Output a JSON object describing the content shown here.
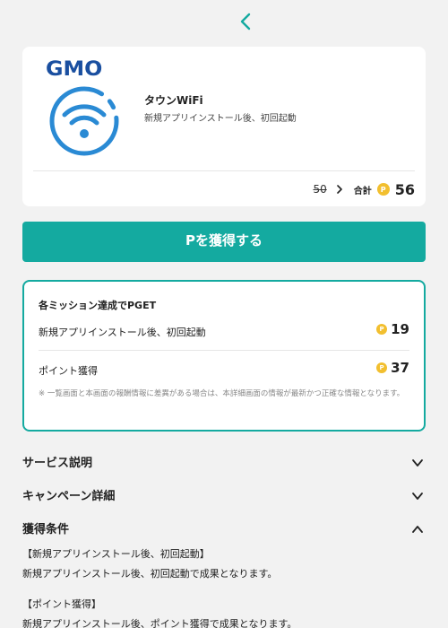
{
  "nav": {
    "back_icon": "chevron-left-icon"
  },
  "app": {
    "logo_text": "GMO",
    "icon": "wifi-icon",
    "name": "タウンWiFi",
    "subtitle": "新規アプリインストール後、初回起動",
    "old_points": "50",
    "total_label": "合計",
    "coin_symbol": "P",
    "total_points": "56"
  },
  "get_button": {
    "label": "Pを獲得する"
  },
  "missions": {
    "title": "各ミッション達成でPGET",
    "items": [
      {
        "label": "新規アプリインストール後、初回起動",
        "points": "19"
      },
      {
        "label": "ポイント獲得",
        "points": "37"
      }
    ],
    "note": "※ 一覧画面と本画面の報酬情報に差異がある場合は、本詳細画面の情報が最新かつ正確な情報となります。"
  },
  "sections": [
    {
      "title": "サービス説明",
      "state": "collapsed"
    },
    {
      "title": "キャンペーン詳細",
      "state": "collapsed"
    },
    {
      "title": "獲得条件",
      "state": "expanded"
    }
  ],
  "conditions": [
    {
      "heading": "【新規アプリインストール後、初回起動】",
      "text": "新規アプリインストール後、初回起動で成果となります。"
    },
    {
      "heading": "【ポイント獲得】",
      "text": "新規アプリインストール後、ポイント獲得で成果となります。"
    }
  ],
  "colors": {
    "accent": "#14aaa0",
    "coin": "#f2bf2f",
    "logo": "#1a4fa0",
    "wifi": "#2a8ad4"
  }
}
